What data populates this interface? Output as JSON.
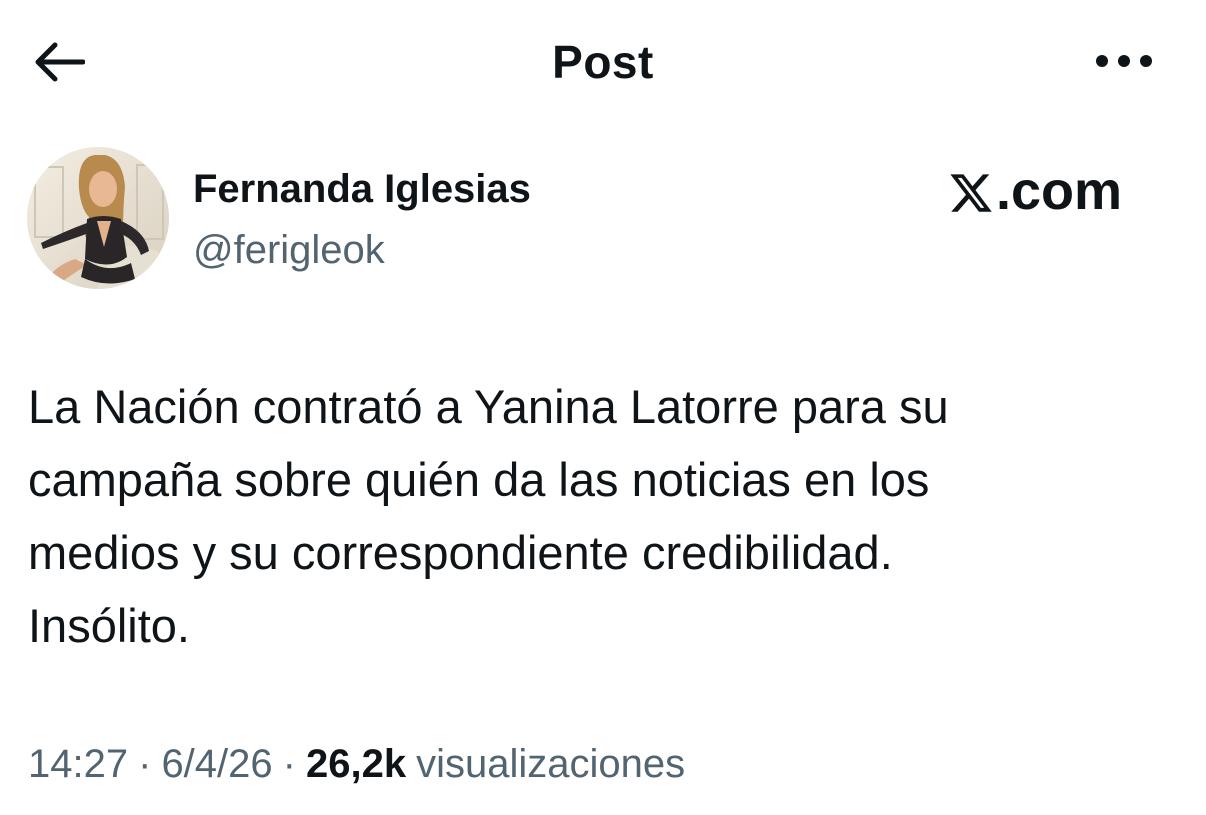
{
  "header": {
    "title": "Post",
    "back_icon": "arrow-left-icon",
    "more_icon": "more-horizontal-icon"
  },
  "author": {
    "name": "Fernanda Iglesias",
    "handle": "@ferigleok",
    "avatar_icon": "profile-photo"
  },
  "brand": {
    "logo_icon": "x-logo-icon",
    "text": ".com"
  },
  "post": {
    "lines": [
      "La Nación contrató a Yanina Latorre para su",
      "campaña sobre quién da las noticias en los",
      "medios y su correspondiente credibilidad.",
      "Insólito."
    ]
  },
  "meta": {
    "time": "14:27",
    "separator": "·",
    "date": "6/4/26",
    "views_count": "26,2k",
    "views_label": "visualizaciones"
  },
  "colors": {
    "text_primary": "#0f1419",
    "text_secondary": "#536471",
    "background": "#ffffff"
  }
}
